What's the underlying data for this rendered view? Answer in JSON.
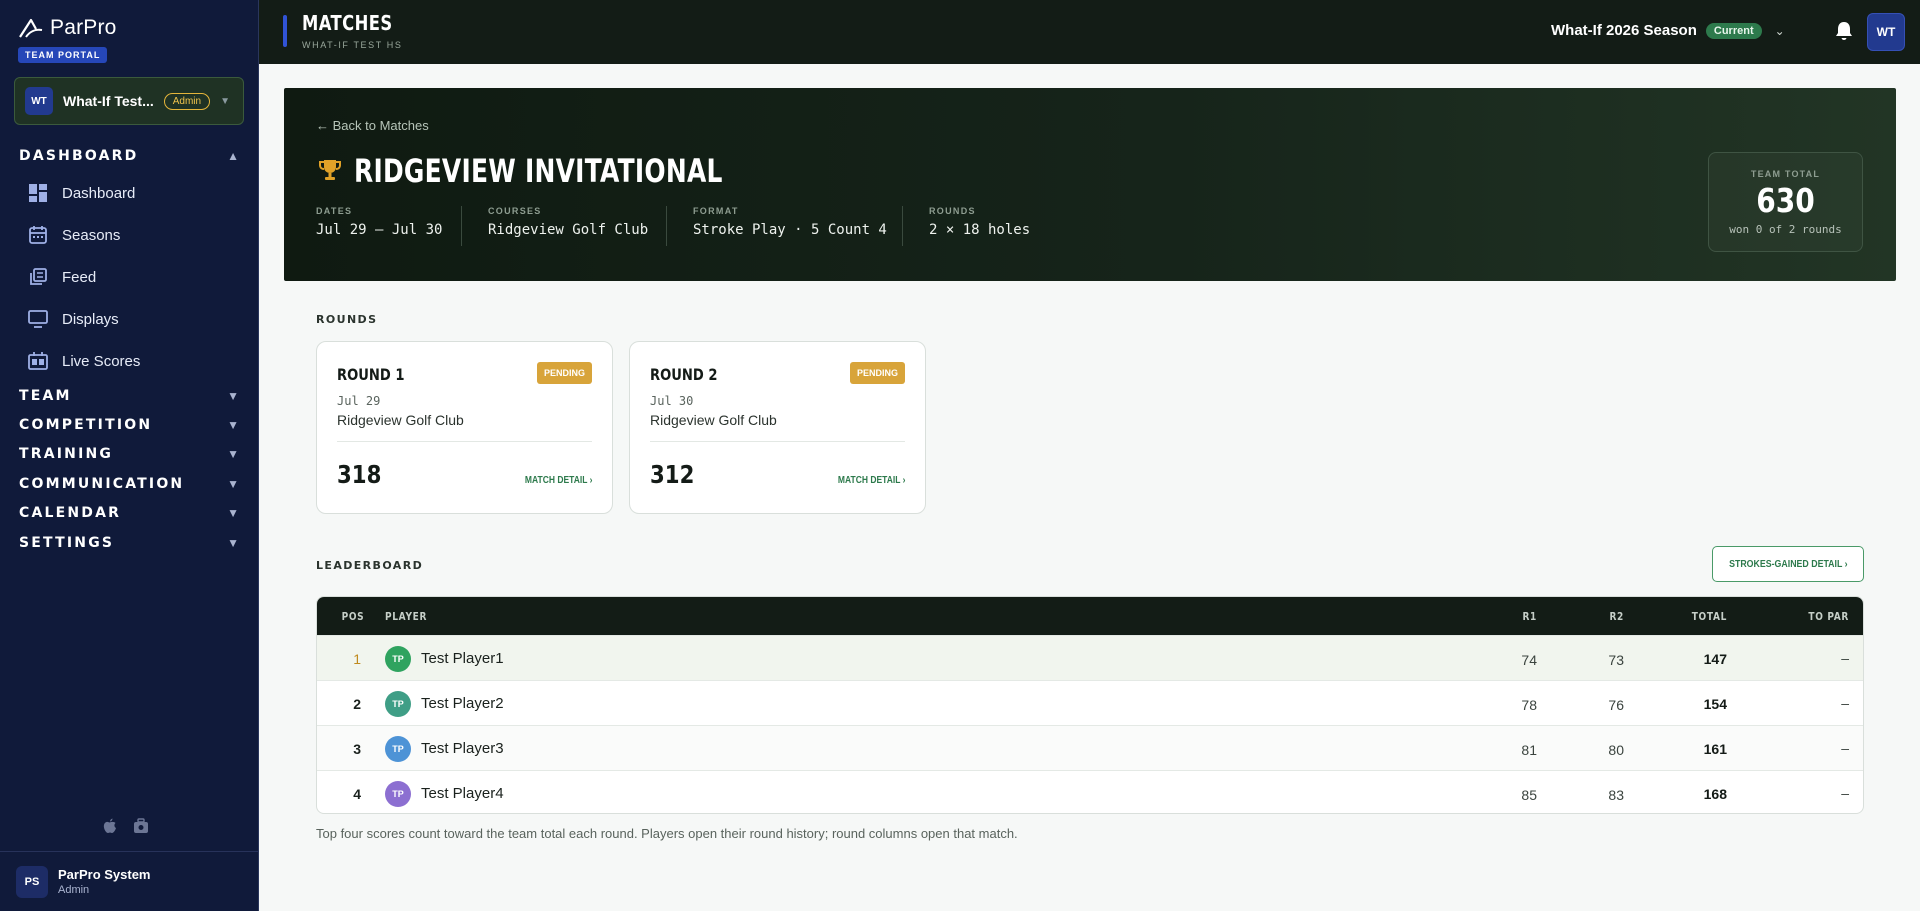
{
  "sidebar": {
    "brand": "ParPro",
    "portal_badge": "TEAM PORTAL",
    "team": {
      "initials": "WT",
      "name": "What-If Test...",
      "role": "Admin"
    },
    "sections": {
      "dashboard": "DASHBOARD",
      "team": "TEAM",
      "competition": "COMPETITION",
      "training": "TRAINING",
      "communication": "COMMUNICATION",
      "calendar": "CALENDAR",
      "settings": "SETTINGS"
    },
    "dashboard_items": [
      "Dashboard",
      "Seasons",
      "Feed",
      "Displays",
      "Live Scores"
    ],
    "user": {
      "initials": "PS",
      "name": "ParPro System",
      "role": "Admin"
    }
  },
  "topbar": {
    "title": "MATCHES",
    "subtitle": "WHAT-IF TEST HS",
    "season": "What-If 2026 Season",
    "season_badge": "Current",
    "user_initials": "WT"
  },
  "event": {
    "back": "← Back to Matches",
    "title": "RIDGEVIEW INVITATIONAL",
    "meta": [
      {
        "key": "DATES",
        "value": "Jul 29 – Jul 30"
      },
      {
        "key": "COURSES",
        "value": "Ridgeview Golf Club"
      },
      {
        "key": "FORMAT",
        "value": "Stroke Play · 5 Count 4"
      },
      {
        "key": "ROUNDS",
        "value": "2 × 18 holes"
      }
    ],
    "team_total": {
      "label": "TEAM TOTAL",
      "value": "630",
      "sub": "won 0 of 2 rounds"
    }
  },
  "rounds_label": "ROUNDS",
  "rounds": [
    {
      "title": "ROUND 1",
      "status": "PENDING",
      "date": "Jul 29",
      "course": "Ridgeview Golf Club",
      "score": "318",
      "link": "MATCH DETAIL ›"
    },
    {
      "title": "ROUND 2",
      "status": "PENDING",
      "date": "Jul 30",
      "course": "Ridgeview Golf Club",
      "score": "312",
      "link": "MATCH DETAIL ›"
    }
  ],
  "leaderboard": {
    "label": "LEADERBOARD",
    "sg_button": "STROKES-GAINED DETAIL ›",
    "columns": {
      "pos": "POS",
      "player": "PLAYER",
      "r1": "R1",
      "r2": "R2",
      "total": "TOTAL",
      "to_par": "TO PAR"
    },
    "rows": [
      {
        "pos": "1",
        "initials": "TP",
        "name": "Test Player1",
        "r1": "74",
        "r2": "73",
        "total": "147",
        "to_par": "–"
      },
      {
        "pos": "2",
        "initials": "TP",
        "name": "Test Player2",
        "r1": "78",
        "r2": "76",
        "total": "154",
        "to_par": "–"
      },
      {
        "pos": "3",
        "initials": "TP",
        "name": "Test Player3",
        "r1": "81",
        "r2": "80",
        "total": "161",
        "to_par": "–"
      },
      {
        "pos": "4",
        "initials": "TP",
        "name": "Test Player4",
        "r1": "85",
        "r2": "83",
        "total": "168",
        "to_par": "–"
      }
    ],
    "note": "Top four scores count toward the team total each round. Players open their round history; round columns open that match."
  },
  "colors": {
    "sidebar_bg": "#101a3a",
    "topbar_bg": "#131c16",
    "accent_green": "#2d7a4c",
    "pending": "#d8a43a",
    "gold": "#e0a128",
    "avatar_colors": [
      "#2fa35f",
      "#3f9e86",
      "#4d93d6",
      "#8c6fd1"
    ]
  },
  "icons": {
    "dashboard": "grid-icon",
    "seasons": "calendar-icon",
    "feed": "feed-icon",
    "displays": "monitor-icon",
    "live_scores": "scoreboard-icon"
  }
}
